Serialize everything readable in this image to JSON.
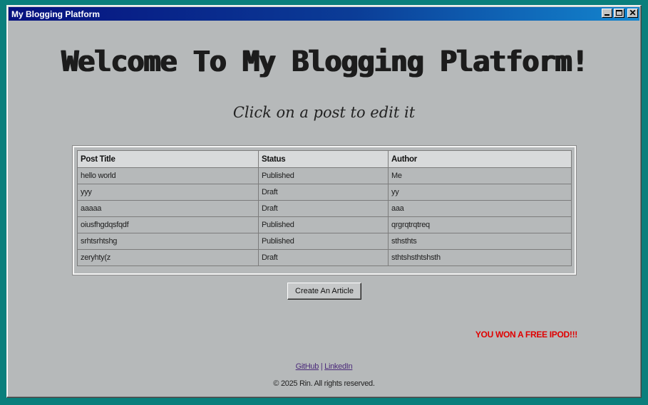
{
  "window": {
    "title": "My Blogging Platform",
    "controls": {
      "minimize": "minimize-icon",
      "maximize": "maximize-icon",
      "close": "close-icon"
    }
  },
  "page": {
    "heading": "Welcome To My Blogging Platform!",
    "subheading": "Click on a post to edit it"
  },
  "table": {
    "headers": [
      "Post Title",
      "Status",
      "Author"
    ],
    "rows": [
      [
        "hello world",
        "Published",
        "Me"
      ],
      [
        "yyy",
        "Draft",
        "yy"
      ],
      [
        "aaaaa",
        "Draft",
        "aaa"
      ],
      [
        "oiusfhgdqsfqdf",
        "Published",
        "qrgrqtrqtreq"
      ],
      [
        "srhtsrhtshg",
        "Published",
        "sthsthts"
      ],
      [
        "zeryhty(z",
        "Draft",
        "sthtshsthtshsth"
      ]
    ]
  },
  "actions": {
    "create_label": "Create An Article"
  },
  "promo": {
    "text": "YOU WON A FREE IPOD!!!",
    "color": "#e00000"
  },
  "footer": {
    "github": "GitHub",
    "separator": "|",
    "linkedin": "LinkedIn",
    "copyright": "© 2025 Rin. All rights reserved."
  },
  "colors": {
    "desktop": "#0a7f7c",
    "titlebar_start": "#06117f",
    "titlebar_end": "#1386cf",
    "window_bg": "#b6b9ba"
  }
}
